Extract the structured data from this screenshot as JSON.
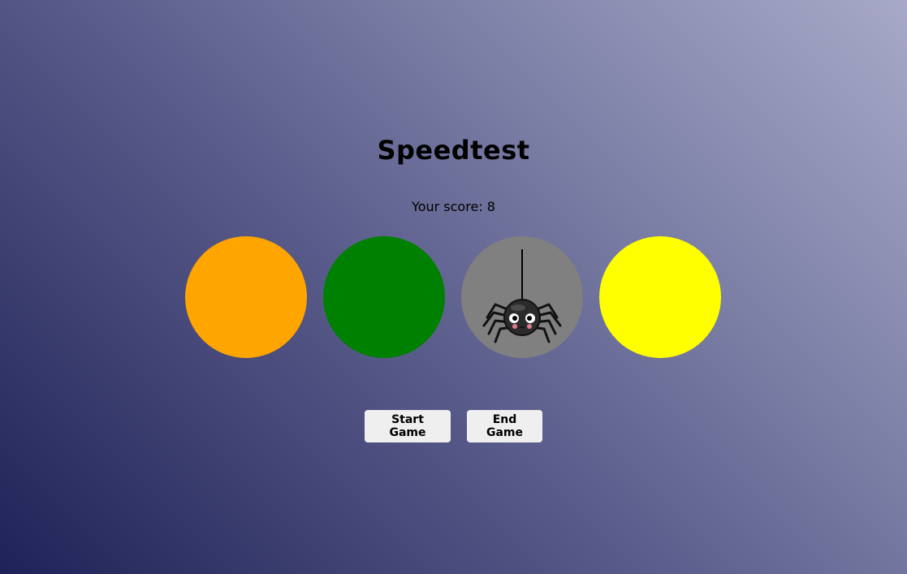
{
  "game": {
    "title": "Speedtest",
    "score_label": "Your score: ",
    "score": "8"
  },
  "circles": [
    {
      "color": "#ffa500",
      "has_spider": false
    },
    {
      "color": "#008000",
      "has_spider": false
    },
    {
      "color": "#808080",
      "has_spider": true
    },
    {
      "color": "#ffff00",
      "has_spider": false
    }
  ],
  "spider": {
    "icon": "spider-icon",
    "body_color": "#2b2b2b",
    "thread_color": "#000000",
    "cheek_color": "#e27b8f"
  },
  "controls": {
    "start_label": "Start Game",
    "end_label": "End Game"
  }
}
